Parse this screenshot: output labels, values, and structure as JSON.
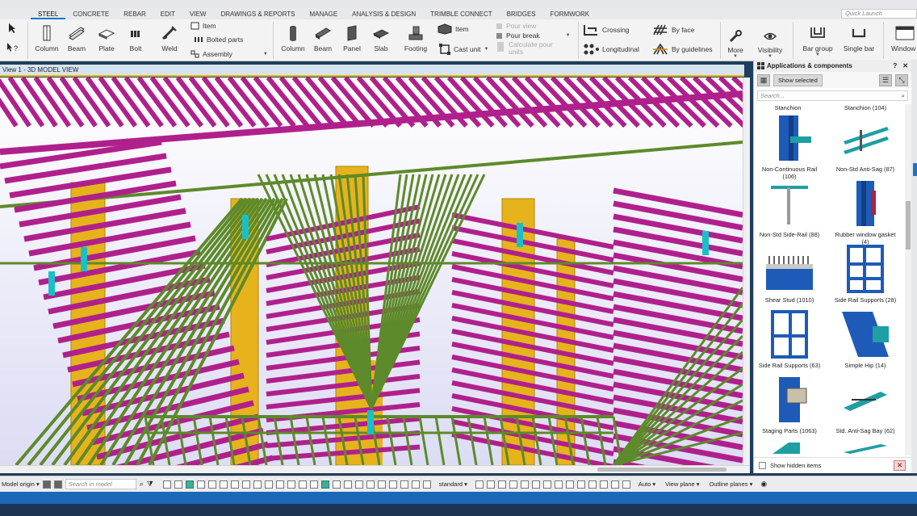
{
  "menu": {
    "tabs": [
      "STEEL",
      "CONCRETE",
      "REBAR",
      "EDIT",
      "VIEW",
      "DRAWINGS & REPORTS",
      "MANAGE",
      "ANALYSIS & DESIGN",
      "TRIMBLE CONNECT",
      "BRIDGES",
      "FORMWORK"
    ],
    "active": "STEEL",
    "quick_launch": "Quick Launch"
  },
  "ribbon": {
    "steel": {
      "column": "Column",
      "beam": "Beam",
      "plate": "Plate",
      "bolt": "Bolt",
      "weld": "Weld",
      "item": "Item",
      "bolted_parts": "Bolted parts",
      "assembly": "Assembly"
    },
    "concrete": {
      "column": "Column",
      "beam": "Beam",
      "panel": "Panel",
      "slab": "Slab",
      "footing": "Footing",
      "item": "Item",
      "cast_unit": "Cast unit",
      "pour_view": "Pour view",
      "pour_break": "Pour break",
      "calc_pour": "Calculate pour units"
    },
    "rebar": {
      "crossing": "Crossing",
      "longitudinal": "Longitudinal",
      "by_face": "By face",
      "by_guidelines": "By guidelines"
    },
    "more": "More",
    "visibility": "Visibility",
    "bar_group": "Bar group",
    "single_bar": "Single bar",
    "window": "Window"
  },
  "view": {
    "title": "View 1 - 3D MODEL VIEW"
  },
  "panel": {
    "title": "Applications & components",
    "show_selected": "Show selected",
    "search_placeholder": "Search...",
    "show_hidden": "Show hidden items",
    "header_labels": [
      "Stanchion",
      "Stanchion (104)"
    ],
    "items": [
      {
        "label": "Non-Continuous Rail (106)",
        "icon": "non-continuous-rail-icon"
      },
      {
        "label": "Non-Std Anti-Sag (87)",
        "icon": "anti-sag-icon"
      },
      {
        "label": "Non-Std Side-Rail (88)",
        "icon": "side-rail-icon"
      },
      {
        "label": "Rubber window gasket (4)",
        "icon": "window-gasket-icon"
      },
      {
        "label": "Shear Stud (1010)",
        "icon": "shear-stud-icon"
      },
      {
        "label": "Side Rail Supports (28)",
        "icon": "side-rail-supports-icon"
      },
      {
        "label": "Side Rail Supports (63)",
        "icon": "side-rail-supports-icon"
      },
      {
        "label": "Simple Hip (14)",
        "icon": "simple-hip-icon"
      },
      {
        "label": "Staging Parts (1063)",
        "icon": "staging-parts-icon"
      },
      {
        "label": "Std. Anti-Sag Bay (62)",
        "icon": "anti-sag-bay-icon"
      }
    ]
  },
  "status": {
    "model_origin": "Model origin",
    "search_placeholder": "Search in model",
    "standard": "standard",
    "auto": "Auto",
    "view_plane": "View plane",
    "outline_planes": "Outline planes"
  },
  "colors": {
    "accent": "#1a75c9",
    "beam_magenta": "#b0208c",
    "member_green": "#5d8a2a",
    "column_yellow": "#e6b31d",
    "cyan": "#19c0c8"
  }
}
